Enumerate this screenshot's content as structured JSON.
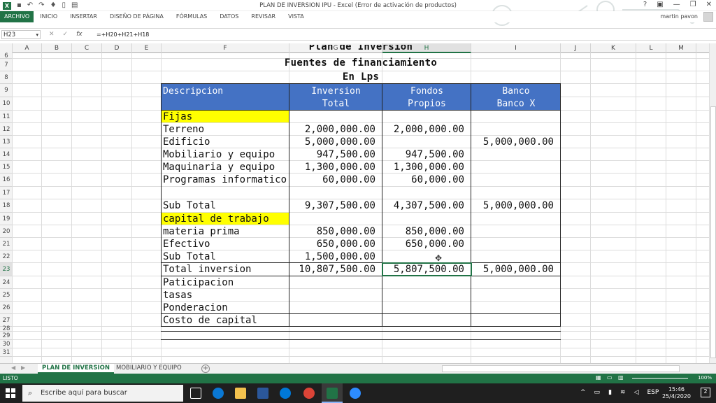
{
  "window": {
    "title": "PLAN DE INVERSION IPU - Excel (Error de activación de productos)",
    "controls": [
      "?",
      "▣",
      "—",
      "❐",
      "✕"
    ],
    "user": "martin pavon"
  },
  "ribbon_tabs": [
    "ARCHIVO",
    "INICIO",
    "INSERTAR",
    "DISEÑO DE PÁGINA",
    "FÓRMULAS",
    "DATOS",
    "REVISAR",
    "VISTA"
  ],
  "formula_bar": {
    "name_box": "H23",
    "fx": "fx",
    "formula": "=+H20+H21+H18"
  },
  "columns": [
    "A",
    "B",
    "C",
    "D",
    "E",
    "F",
    "G",
    "H",
    "I",
    "J",
    "K",
    "L",
    "M"
  ],
  "selected_column": "H",
  "rows": [
    "6",
    "7",
    "8",
    "9",
    "10",
    "11",
    "12",
    "13",
    "14",
    "15",
    "16",
    "17",
    "18",
    "19",
    "20",
    "21",
    "22",
    "23",
    "24",
    "25",
    "26",
    "27",
    "28",
    "29",
    "30",
    "31"
  ],
  "selected_row": "23",
  "sheet": {
    "title_cut": "Plan de Inversion",
    "title2": "Fuentes de financiamiento",
    "title3": "En Lps",
    "headers": {
      "descripcion": "Descripcion",
      "inversion_1": "Inversion",
      "inversion_2": "Total",
      "fondos_1": "Fondos",
      "fondos_2": "Propios",
      "banco_1": "Banco",
      "banco_2": "Banco X"
    },
    "rows": [
      {
        "label": "Fijas",
        "inv": "",
        "fondos": "",
        "banco": ""
      },
      {
        "label": "Terreno",
        "inv": "2,000,000.00",
        "fondos": "2,000,000.00",
        "banco": ""
      },
      {
        "label": "Edificio",
        "inv": "5,000,000.00",
        "fondos": "",
        "banco": "5,000,000.00"
      },
      {
        "label": "Mobiliario y equipo",
        "inv": "947,500.00",
        "fondos": "947,500.00",
        "banco": ""
      },
      {
        "label": "Maquinaria y equipo",
        "inv": "1,300,000.00",
        "fondos": "1,300,000.00",
        "banco": ""
      },
      {
        "label": "Programas informatico",
        "inv": "60,000.00",
        "fondos": "60,000.00",
        "banco": ""
      },
      {
        "label": "",
        "inv": "",
        "fondos": "",
        "banco": ""
      },
      {
        "label": "Sub Total",
        "inv": "9,307,500.00",
        "fondos": "4,307,500.00",
        "banco": "5,000,000.00"
      },
      {
        "label": "capital de trabajo",
        "inv": "",
        "fondos": "",
        "banco": ""
      },
      {
        "label": "materia prima",
        "inv": "850,000.00",
        "fondos": "850,000.00",
        "banco": ""
      },
      {
        "label": "Efectivo",
        "inv": "650,000.00",
        "fondos": "650,000.00",
        "banco": ""
      },
      {
        "label": "Sub Total",
        "inv": "1,500,000.00",
        "fondos": "",
        "banco": ""
      },
      {
        "label": "Total inversion",
        "inv": "10,807,500.00",
        "fondos": "5,807,500.00",
        "banco": "5,000,000.00"
      },
      {
        "label": "Paticipacion",
        "inv": "",
        "fondos": "",
        "banco": ""
      },
      {
        "label": "tasas",
        "inv": "",
        "fondos": "",
        "banco": ""
      },
      {
        "label": "Ponderacion",
        "inv": "",
        "fondos": "",
        "banco": ""
      },
      {
        "label": "Costo de capital",
        "inv": "",
        "fondos": "",
        "banco": ""
      }
    ]
  },
  "sheet_tabs": [
    "PLAN DE INVERSION",
    "MOBILIARIO Y EQUIPO"
  ],
  "active_sheet": "PLAN DE INVERSION",
  "status": {
    "left": "LISTO",
    "zoom": "100%"
  },
  "taskbar": {
    "search_placeholder": "Escribe aquí para buscar",
    "lang": "ESP",
    "time": "15:46",
    "date": "25/4/2020",
    "notif_count": "2"
  },
  "colors": {
    "excel_green": "#217346",
    "header_blue": "#4472c4",
    "highlight_yellow": "#ffff00"
  }
}
